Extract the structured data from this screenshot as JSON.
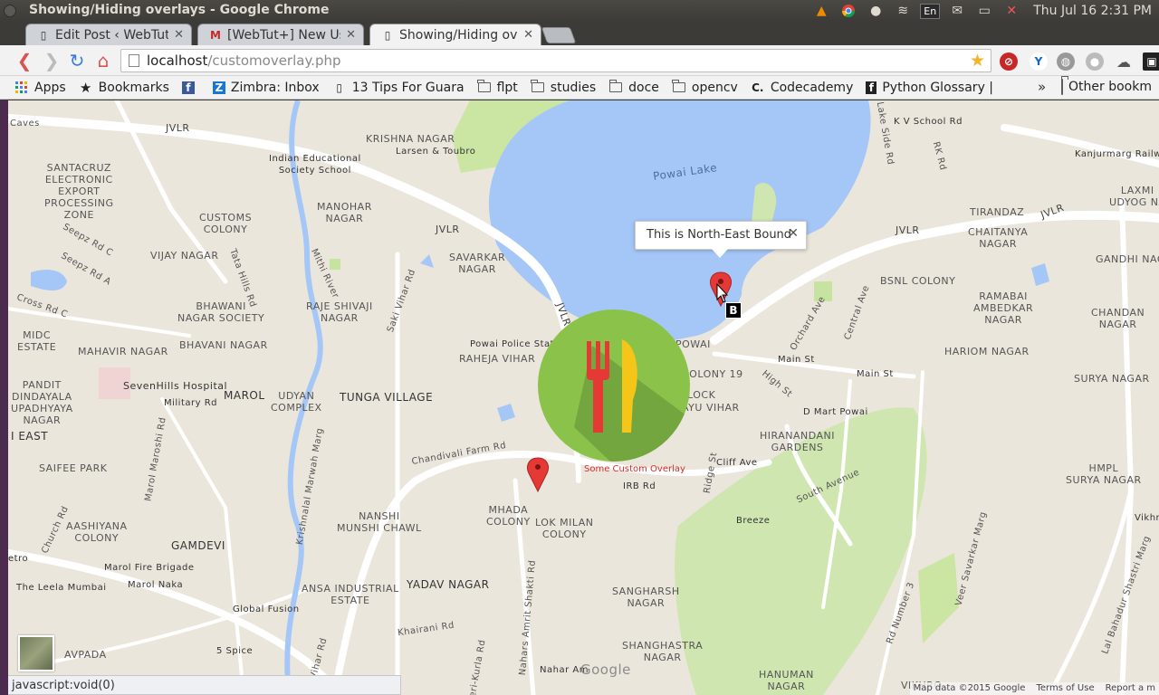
{
  "window": {
    "title": "Showing/Hiding overlays - Google Chrome"
  },
  "tray": {
    "input_method": "En",
    "clock": "Thu Jul 16  2:31 PM"
  },
  "tabs": [
    {
      "label": "Edit Post ‹ WebTut+",
      "favicon": "wordpress-icon",
      "active": false
    },
    {
      "label": "[WebTut+] New User",
      "favicon": "gmail-icon",
      "active": false
    },
    {
      "label": "Showing/Hiding ove",
      "favicon": "page-icon",
      "active": true
    }
  ],
  "omnibox": {
    "host": "localhost",
    "path": "/customoverlay.php"
  },
  "bookmarks": {
    "items": [
      {
        "label": "Apps",
        "icon": "apps-grid-icon"
      },
      {
        "label": "Bookmarks",
        "icon": "star-icon"
      },
      {
        "label": "",
        "icon": "facebook-icon"
      },
      {
        "label": "Zimbra: Inbox",
        "icon": "zimbra-icon"
      },
      {
        "label": "13 Tips For Guara",
        "icon": "page-icon"
      },
      {
        "label": "flpt",
        "icon": "folder-icon"
      },
      {
        "label": "studies",
        "icon": "folder-icon"
      },
      {
        "label": "doce",
        "icon": "folder-icon"
      },
      {
        "label": "opencv",
        "icon": "folder-icon"
      },
      {
        "label": "Codecademy",
        "icon": "codecademy-icon"
      },
      {
        "label": "Python Glossary |",
        "icon": "python-icon"
      }
    ],
    "more": "»",
    "other": "Other bookm"
  },
  "map": {
    "info_window": {
      "text": "This is North-East Bound"
    },
    "overlay_caption": "Some Custom Overlay",
    "marker_label": "B",
    "google_logo": "Google",
    "attribution": {
      "data": "Map data ©2015 Google",
      "terms": "Terms of Use",
      "report": "Report a m"
    },
    "labels": {
      "caves": "Caves",
      "jvlr1": "JVLR",
      "jvlr2": "JVLR",
      "jvlr3": "JVLR",
      "jvlr4": "JVLR",
      "jvlr5": "JVLR",
      "krishna": "KRISHNA NAGAR",
      "larsen": "Larsen & Toubro",
      "kvschool": "K V School Rd",
      "lakeside": "Lake Side Rd",
      "rkrd": "RK Rd",
      "kanjur": "Kanjurmarg Railwa",
      "santacruz": "SANTACRUZ\nELECTRONIC\nEXPORT\nPROCESSING\nZONE",
      "iescl": "Indian Educational\nSociety School",
      "powailake": "Powai Lake",
      "laxmi": "LAXMI\nUDYOG NA",
      "tirandaz": "TIRANDAZ",
      "chaitanya": "CHAITANYA\nNAGAR",
      "gandhi": "GANDHI NAGA",
      "customs": "CUSTOMS\nCOLONY",
      "manohar": "MANOHAR\nNAGAR",
      "seepzc": "Seepz Rd C",
      "seepza": "Seepz Rd A",
      "tatahills": "Tata Hills Rd",
      "savarkar": "SAVARKAR\nNAGAR",
      "mithiriver": "Mithi River",
      "vijay": "VIJAY NAGAR",
      "bhawani": "BHAWANI\nNAGAR SOCIETY",
      "rajeshivaji": "RAJE SHIVAJI\nNAGAR",
      "sakivihar": "Saki Vihar Rd",
      "bsnl": "BSNL COLONY",
      "ramabai": "RAMABAI\nAMBEDKAR\nNAGAR",
      "chandan": "CHANDAN\nNAGAR",
      "crossc": "Cross Rd C",
      "midc": "MIDC\nESTATE",
      "mahavir": "MAHAVIR NAGAR",
      "bhavaninagar": "BHAVANI NAGAR",
      "powaipolice": "Powai Police Stati",
      "rahejavihar": "RAHEJA VIHAR",
      "powai": "POWAI",
      "orchard": "Orchard Ave",
      "central": "Central Ave",
      "mainst1": "Main St",
      "mainst2": "Main St",
      "hariom": "HARIOM NAGAR",
      "surya": "SURYA NAGAR",
      "pandit": "PANDIT\nDINDAYALA\nUPADHYAYA\nNAGAR",
      "sevenhills": "SevenHills Hospital",
      "marol": "MAROL",
      "military": "Military Rd",
      "udyan": "UDYAN\nCOMPLEX",
      "tunga": "TUNGA VILLAGE",
      "highst": "High St",
      "dmart": "D Mart Powai",
      "iEast": "I EAST",
      "saifee": "SAIFEE PARK",
      "marolmaroshi": "Marol Maroshi Rd",
      "krishnalal": "Krishnalal Marwah Marg",
      "chandivali": "Chandivali Farm Rd",
      "hiranandani": "HIRANANDANI\nGARDENS",
      "cliff": "Cliff Ave",
      "ridge": "Ridge St",
      "southave": "South Avenue",
      "hmpl": "HMPL\nSURYA NAGAR",
      "irb": "IRB Rd",
      "churchrd": "Church Rd",
      "aashiyana": "AASHIYANA\nCOLONY",
      "nanshi": "NANSHI\nMUNSHI CHAWL",
      "mhada": "MHADA\nCOLONY",
      "lokmilan": "LOK MILAN\nCOLONY",
      "breeze": "Breeze",
      "vikhroli": "Vikhro",
      "gamdevi": "GAMDEVI",
      "etro": "etro",
      "marolfire": "Marol Fire Brigade",
      "leela": "The Leela Mumbai",
      "marolnaka": "Marol Naka",
      "ansa": "ANSA INDUSTRIAL\nESTATE",
      "yadav": "YADAV NAGAR",
      "sangharsh": "SANGHARSH\nNAGAR",
      "globalfusion": "Global Fusion",
      "veersavarkar": "Veer Savarkar Marg",
      "lbs": "Lal Bahadur Shastri Marg",
      "rdnum3": "Rd Number 3",
      "amrit": "Nahars Amrit Shakti Rd",
      "avpada": "AVPADA",
      "fivespice": "5 Spice",
      "khairani": "Khairani Rd",
      "andheri": "Andheri-Kurla Rd",
      "shanghastra": "SHANGHASTRA\nNAGAR",
      "nahar": "Nahar Am",
      "hanuman": "HANUMAN\nNAGAR",
      "vikhroli2": "VIKHRO",
      "vihar": "Vihar Rd",
      "colony19": "COLONY 19",
      "lock": "LOCK",
      "ayuvihar": "AYU VIHAR",
      "dn": "D"
    }
  },
  "status": {
    "text": "javascript:void(0)"
  }
}
